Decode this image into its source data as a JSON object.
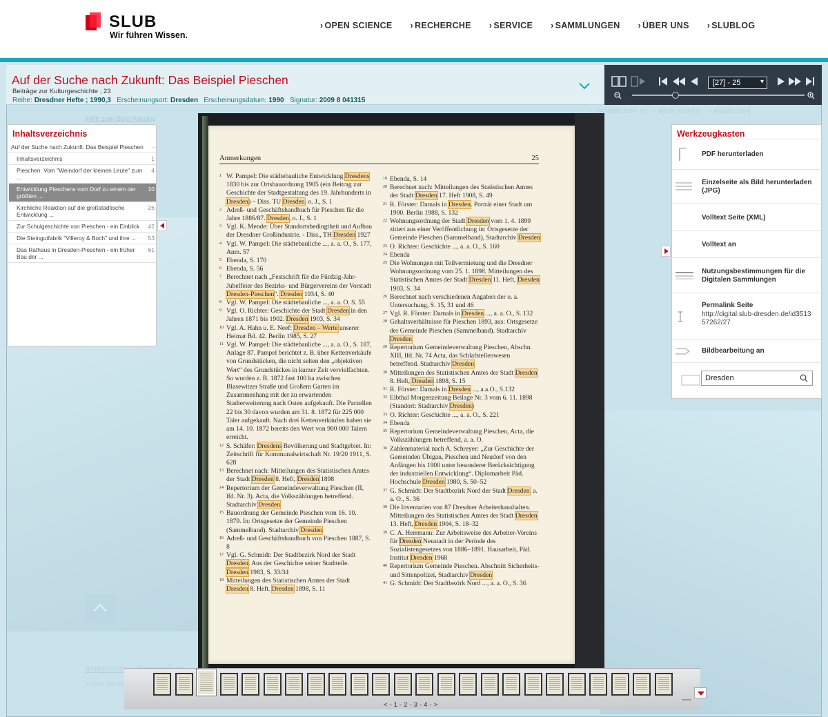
{
  "header": {
    "logo_text": "SLUB",
    "logo_tagline": "Wir führen Wissen.",
    "nav": [
      "OPEN SCIENCE",
      "RECHERCHE",
      "SERVICE",
      "SAMMLUNGEN",
      "ÜBER UNS",
      "SLUBLOG"
    ]
  },
  "document": {
    "title": "Auf der Suche nach Zukunft: Das Beispiel Pieschen",
    "series": "Beiträge zur Kulturgeschichte ; 23",
    "reihe_label": "Reihe:",
    "reihe_value": "Dresdner Hefte ; 1990,3",
    "ort_label": "Erscheinungsort:",
    "ort_value": "Dresden",
    "datum_label": "Erscheinungsdatum:",
    "datum_value": "1990",
    "signatur_label": "Signatur:",
    "signatur_value": "2009 8 041315"
  },
  "toolbar": {
    "page_select": "[27] - 25"
  },
  "background_ghost": {
    "help_link": "Hilfe zum Beta Katalog",
    "g1": "› Sammelbox (0)",
    "g2": "› Mein Konto",
    "g3": "› Anmelden"
  },
  "toc": {
    "heading": "Inhaltsverzeichnis",
    "items": [
      {
        "label": "Auf der Suche nach Zukunft: Das Beispiel Pieschen",
        "page": "-"
      },
      {
        "label": "Inhaltsverzeichnis",
        "page": "1"
      },
      {
        "label": "Pieschen: Vom \"Weindorf der kleinen Leute\" zum ...",
        "page": "4"
      },
      {
        "label": "Entwicklung Pieschens vom Dorf zu einem der größten ...",
        "page": "10"
      },
      {
        "label": "Kirchliche Reaktion auf die großstädtische Entwicklung ...",
        "page": "26"
      },
      {
        "label": "Zur Schulgeschichte von Pieschen - ein Einblick",
        "page": "42"
      },
      {
        "label": "Die Steingutfabrik \"Villeroy & Boch\" und ihre ...",
        "page": "53"
      },
      {
        "label": "Das Rathaus in Dresden-Pieschen - ein früher Bau der ...",
        "page": "61"
      }
    ]
  },
  "scan": {
    "heading": "Anmerkungen",
    "page_number": "25",
    "highlight_term": "Dresden",
    "left_column": [
      {
        "n": "1",
        "t": "W. Pampel: Die städtebauliche Entwicklung [Dresdens] 1830 bis zur Ortsbauordnung 1905 (ein Beitrag zur Geschichte der Stadtgestaltung des 19. Jahrhunderts in [Dresden]) – Diss. TU [Dresden], o. J., S. 1"
      },
      {
        "n": "2",
        "t": "Adreß- und Geschäftshandbuch für Pieschen für die Jahre 1886/87. [Dresden], o. J., S. 1"
      },
      {
        "n": "3",
        "t": "Vgl. K. Mende: Über Standortsbedingtheit und Aufbau der Dresdner Großindustrie. - Diss., TH [Dresden] 1927"
      },
      {
        "n": "4",
        "t": "Vgl. W. Pampel: Die städtebauliche ..., a. a. O., S. 177, Anm. 57"
      },
      {
        "n": "5",
        "t": "Ebenda, S. 170"
      },
      {
        "n": "6",
        "t": "Ebenda, S. 56"
      },
      {
        "n": "7",
        "t": "Berechnet nach „Festschrift für die Fünfzig-Jahr-Jubelfeier des Bezirks- und Bürgervereins der Vorstadt [Dresden-Pieschen]“. [Dresden] 1934, S. 40"
      },
      {
        "n": "8",
        "t": "Vgl. W. Pampel: Die städtebauliche ..., a. a. O. S. 55"
      },
      {
        "n": "9",
        "t": "Vgl. O. Richter: Geschichte der Stadt [Dresden] in den Jahren 1871 bis 1902. [Dresden] 1903, S. 34"
      },
      {
        "n": "10",
        "t": "Vgl. A. Hahn u. E. Neef: [Dresden – Werte] unserer Heimat Bd. 42. Berlin 1985, S. 27"
      },
      {
        "n": "11",
        "t": "Vgl. W. Pampel: Die städtebauliche ..., a. a. O., S. 187, Anlage 87. Pampel berichtet z. B. über Kettenverkäufe von Grundstücken, die nicht selten den „objektiven Wert“ des Grundstückes in kurzer Zeit vervielfachten. So wurden z. B. 1872 fast 100 ha zwischen Blasewitzer Straße und Großem Garten im Zusammenhang mit der zu erwartenden Stadterweiterung nach Osten aufgekauft. Die Parzellen 22 bis 30 davon wurden am 31. 8. 1872 für 225 000 Taler aufgekauft. Nach drei Kettenverkäufen haben sie am 14. 10. 1872 bereits den Wert von 900 000 Talern erreicht."
      },
      {
        "n": "12",
        "t": "S. Schäfer: [Dresdens] Bevölkerung und Stadtgebiet. In: Zeitschrift für Kommunalwirtschaft Nr. 19/20 1911, S. 628"
      },
      {
        "n": "13",
        "t": "Berechnet nach: Mitteilungen des Statistischen Amtes der Stadt [Dresden] 8. Heft, [Dresden] 1898"
      },
      {
        "n": "14",
        "t": "Repertorium der Gemeindeverwaltung Pieschen (II, lfd. Nr. 3). Acta, die Volkszählungen betreffend. Stadtarchiv [Dresden]"
      },
      {
        "n": "15",
        "t": "Bauordnung der Gemeinde Pieschen vom 16. 10. 1879. In: Ortsgesetze der Gemeinde Pieschen (Sammelband). Stadtarchiv [Dresden]"
      },
      {
        "n": "16",
        "t": "Adreß- und Geschäftshandbuch von Pieschen 1887, S. 8"
      },
      {
        "n": "17",
        "t": "Vgl. G. Schmidt: Der Stadtbezirk Nord der Stadt [Dresden]. Aus der Geschichte seiner Stadtteile. [Dresden] 1983, S. 33/34"
      },
      {
        "n": "18",
        "t": "Mitteilungen des Statistischen Amtes der Stadt [Dresden] 8. Heft. [Dresden] 1898, S. 11"
      }
    ],
    "right_column": [
      {
        "n": "19",
        "t": "Ebenda, S. 14"
      },
      {
        "n": "20",
        "t": "Berechnet nach: Mitteilungen des Statistischen Amtes der Stadt [Dresden] 17. Heft 1908, S. 49"
      },
      {
        "n": "21",
        "t": "R. Förster: Damals in [Dresden]. Porträt einer Stadt um 1900. Berlin 1988, S. 132"
      },
      {
        "n": "22",
        "t": "Wohnungsordnung der Stadt [Dresden] vom 1. 4. 1899 zitiert aus einer Veröffentlichung in: Ortsgesetze der Gemeinde Pieschen (Sammelband), Stadtarchiv [Dresden]"
      },
      {
        "n": "23",
        "t": "O. Richter: Geschichte ..., a. a. O., S. 160"
      },
      {
        "n": "24",
        "t": "Ebenda"
      },
      {
        "n": "25",
        "t": "Die Wohnungen mit Teilvermietung und die Dresdner Wohnungsordnung vom 25. 1. 1898. Mitteilungen des Statistischen Amtes der Stadt [Dresden] 11. Heft, [Dresden] 1903, S. 34"
      },
      {
        "n": "26",
        "t": "Berechnet nach verschiedenen Angaben der o. a. Untersuchung, S. 15, 31 und 46"
      },
      {
        "n": "27",
        "t": "Vgl. R. Förster: Damals in [Dresden] ..., a. a. O., S. 132"
      },
      {
        "n": "28",
        "t": "Gehaltsverhältnisse für Pieschen 1893, aus: Ortsgesetze der Gemeinde Pieschen (Sammelband). Stadtarchiv [Dresden]"
      },
      {
        "n": "29",
        "t": "Repertorium Gemeindeverwaltung Pieschen, Abschn. XIII, lfd. Nr. 74 Acta, das Schlafstellenwesen betreffend. Stadtarchiv [Dresden]"
      },
      {
        "n": "30",
        "t": "Mitteilungen des Statistischen Amtes der Stadt [Dresden] 8. Heft, [Dresden] 1898, S. 15"
      },
      {
        "n": "31",
        "t": "R. Förster: Damals in [Dresden] ..., a.a.O., S.132"
      },
      {
        "n": "32",
        "t": "Elbthal Morgenzeitung Beilage Nr. 3 vom 6. 11. 1898 (Standort: Stadtarchiv [Dresden])"
      },
      {
        "n": "33",
        "t": "O. Richter: Geschichte ..., a. a. O., S. 221"
      },
      {
        "n": "34",
        "t": "Ebenda"
      },
      {
        "n": "35",
        "t": "Repertorium Gemeindeverwaltung Pieschen, Acta, die Volkszählungen betreffend, a. a. O."
      },
      {
        "n": "36",
        "t": "Zahlenmaterial nach A. Schreyer: „Zur Geschichte der Gemeinden Übigau, Pieschen und Neudorf von den Anfängen bis 1900 unter besonderer Berücksichtigung der industriellen Entwicklung“. Diplomarbeit Päd. Hochschule [Dresden] 1980, S. 50–52"
      },
      {
        "n": "37",
        "t": "G. Schmidt: Der Stadtbezirk Nord der Stadt [Dresden], a. a. O., S. 36"
      },
      {
        "n": "38",
        "t": "Die Inventarien von 87 Dresdner Arbeiterhaushalten. Mitteilungen des Statistischen Amtes der Stadt [Dresden] 13. Heft, [Dresden] 1904, S. 18–32"
      },
      {
        "n": "39",
        "t": "C. A. Herrmann: Zur Arbeitsweise des Arbeiter-Vereins für [Dresden] Neustadt in der Periode des Sozialistengesetzes von 1886–1891. Hausarbeit, Päd. Institut [Dresden] 1968"
      },
      {
        "n": "40",
        "t": "Repertorium Gemeinde Pieschen. Abschnitt Sicherheits- und Sittenpolizei, Stadtarchiv [Dresden]"
      },
      {
        "n": "41",
        "t": "G. Schmidt: Der Stadtbezirk Nord ..., a. a. O., S. 36"
      }
    ]
  },
  "tools": {
    "heading": "Werkzeugkasten",
    "items": [
      {
        "label": "PDF herunterladen",
        "icon": "pdf-icon"
      },
      {
        "label": "Einzelseite als Bild herunterladen (JPG)",
        "icon": "image-icon"
      },
      {
        "label": "Volltext Seite (XML)",
        "icon": "xml-icon"
      },
      {
        "label": "Volltext an",
        "icon": "fulltext-icon"
      },
      {
        "label": "Nutzungsbestimmungen für die Digitalen Sammlungen",
        "icon": "license-icon"
      },
      {
        "label": "Permalink Seite",
        "icon": "link-icon"
      },
      {
        "label": "Bildbearbeitung an",
        "icon": "edit-image-icon"
      }
    ],
    "permalink_url": "http://digital.slub-dresden.de/id351357262/27",
    "search_value": "Dresden"
  },
  "footer_ghost": {
    "impressum": "Impressum",
    "datenschutz": "Datenschutz",
    "copyright": "© 2018, Sächsische Landesbibliothek"
  },
  "thumbnails": {
    "count": 24,
    "current_index": 2,
    "pager": [
      "<",
      "-",
      "1",
      "-",
      "2",
      "-",
      "3",
      "-",
      "4",
      "-",
      ">"
    ]
  }
}
